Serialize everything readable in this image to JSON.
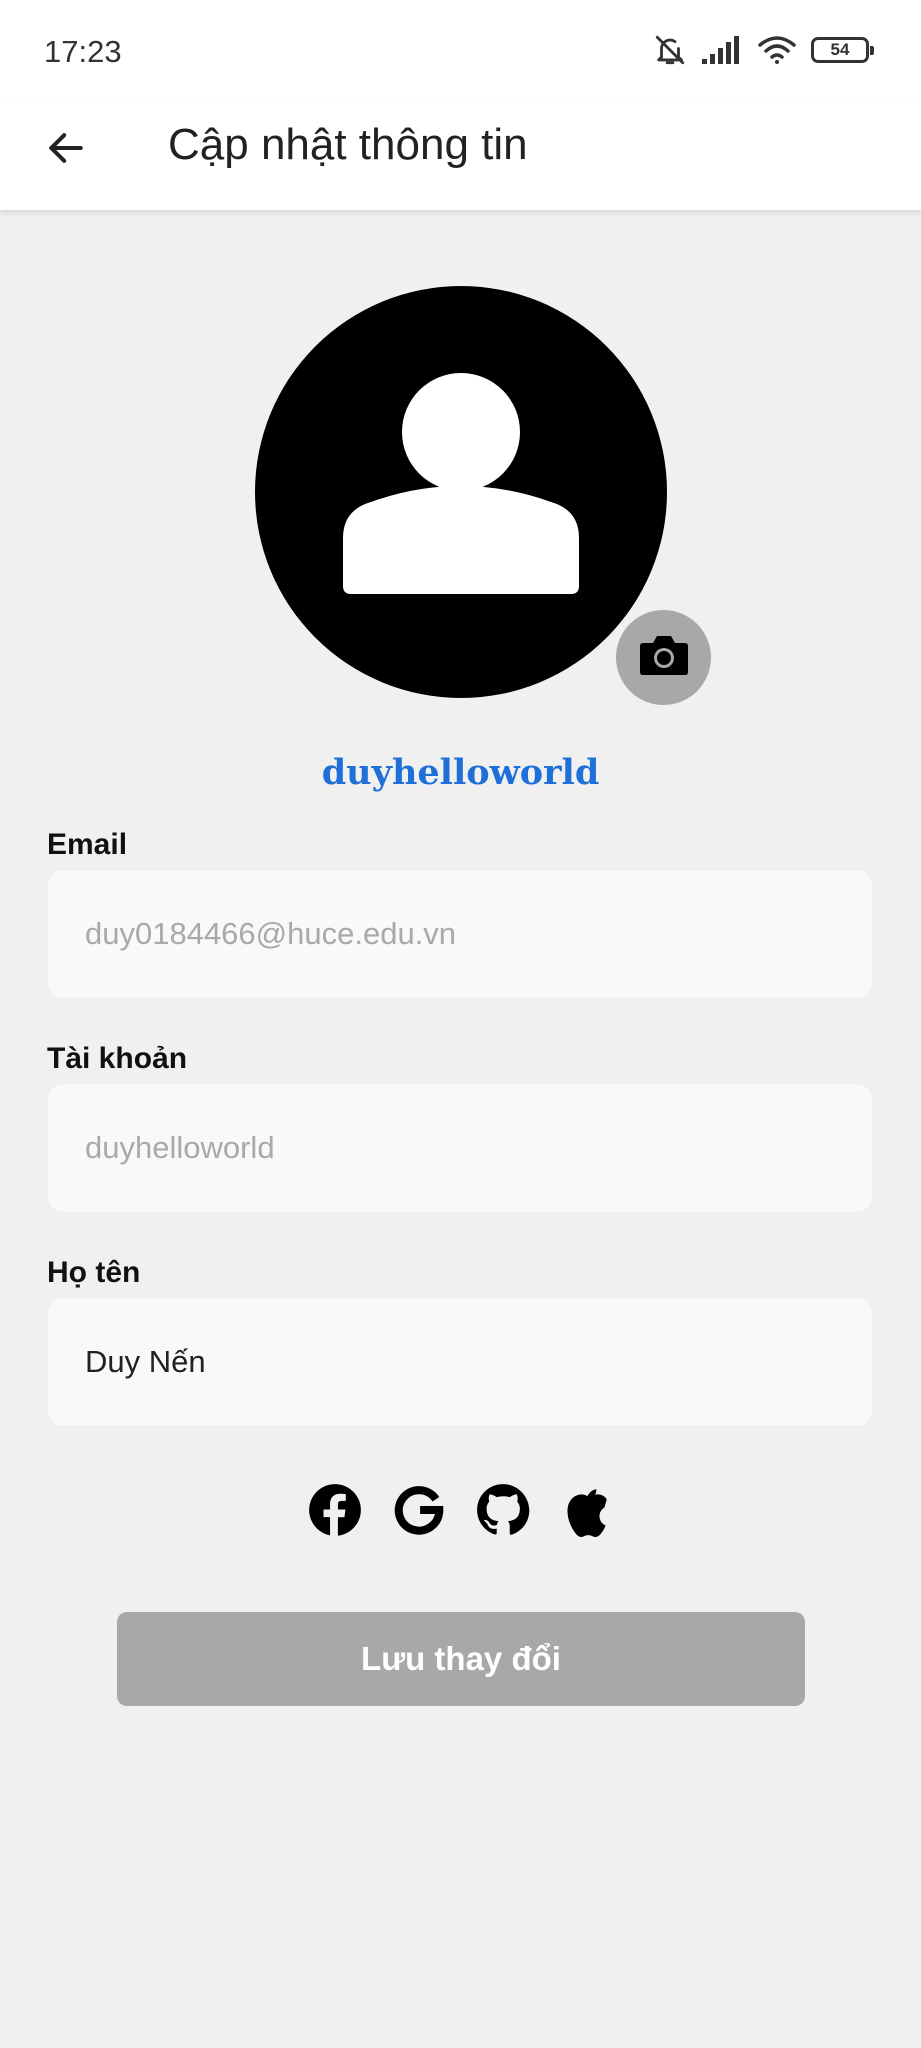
{
  "status_bar": {
    "time": "17:23",
    "icons": [
      "bell-off-icon",
      "signal-icon",
      "wifi-icon",
      "battery-icon"
    ],
    "battery_level": "54"
  },
  "app_bar": {
    "back_icon": "arrow-left-icon",
    "title": "Cập nhật thông tin"
  },
  "profile": {
    "avatar_icon": "person-placeholder-icon",
    "camera_icon": "camera-icon",
    "username": "duyhelloworld"
  },
  "form": {
    "email": {
      "label": "Email",
      "value": "duy0184466@huce.edu.vn"
    },
    "account": {
      "label": "Tài khoản",
      "value": "duyhelloworld"
    },
    "full_name": {
      "label": "Họ tên",
      "value": "Duy Nến"
    }
  },
  "social_icons": [
    "facebook-icon",
    "google-icon",
    "github-icon",
    "apple-icon"
  ],
  "save_button": {
    "label": "Lưu thay đổi"
  },
  "colors": {
    "background": "#f0f0f0",
    "app_bar": "#ffffff",
    "username": "#1f6fd8",
    "button_disabled": "#a8a8a8",
    "readonly_text": "#a9a9a9"
  }
}
